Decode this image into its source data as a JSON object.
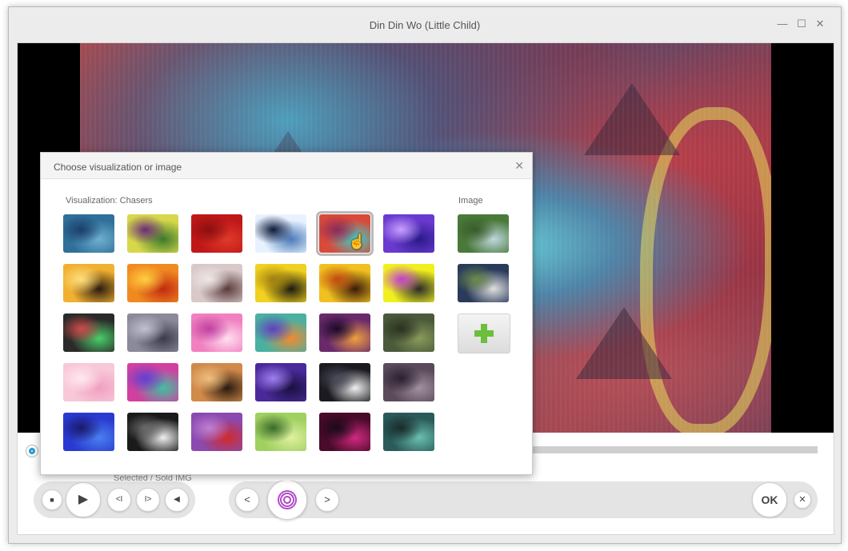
{
  "window": {
    "title": "Din Din Wo (Little Child)",
    "minimize_icon": "minimize-icon",
    "maximize_icon": "maximize-icon",
    "close_icon": "close-icon",
    "minimize_glyph": "—",
    "maximize_glyph": "☐",
    "close_glyph": "✕"
  },
  "dialog": {
    "title": "Choose visualization or image",
    "close_glyph": "✕",
    "visualization_label": "Visualization: Chasers",
    "image_label": "Image",
    "selected_index": 4,
    "visualizations": [
      {
        "name": "blue-smoke",
        "colors": [
          "#2f6f9a",
          "#6fb0d0",
          "#1b3d6a"
        ]
      },
      {
        "name": "green-burst",
        "colors": [
          "#d6d84a",
          "#3b7a2a",
          "#6a2a7a"
        ]
      },
      {
        "name": "red-plane",
        "colors": [
          "#c01818",
          "#e03a2a",
          "#8a0f0f"
        ]
      },
      {
        "name": "light-tunnel",
        "colors": [
          "#e8f2ff",
          "#4a7ab8",
          "#0c1a3a"
        ]
      },
      {
        "name": "kaleido-teal",
        "colors": [
          "#d84a3a",
          "#3ad0c8",
          "#8a2a5a"
        ]
      },
      {
        "name": "purple-glow",
        "colors": [
          "#6a3ad0",
          "#2a1a8a",
          "#c8a0ff"
        ]
      },
      {
        "name": "gold-streak",
        "colors": [
          "#f0b030",
          "#2a1a10",
          "#ffe080"
        ]
      },
      {
        "name": "fire-nebula",
        "colors": [
          "#f08a20",
          "#c02a10",
          "#ffd040"
        ]
      },
      {
        "name": "film-strip",
        "colors": [
          "#d8c8c8",
          "#5a3a3a",
          "#f0e8e8"
        ]
      },
      {
        "name": "yellow-spikes",
        "colors": [
          "#f0d020",
          "#1a1a10",
          "#a08010"
        ]
      },
      {
        "name": "golden-mask",
        "colors": [
          "#f0c020",
          "#3a1a0a",
          "#c04a10"
        ]
      },
      {
        "name": "stick-dancer",
        "colors": [
          "#f0f020",
          "#2a2a2a",
          "#c040d0"
        ]
      },
      {
        "name": "stick-figures",
        "colors": [
          "#2a2a2a",
          "#4ad06a",
          "#d04a4a"
        ]
      },
      {
        "name": "grey-vortex",
        "colors": [
          "#8a8a9a",
          "#3a3a4a",
          "#c0c0d0"
        ]
      },
      {
        "name": "pink-swirl",
        "colors": [
          "#f080c0",
          "#ffe0f0",
          "#c040a0"
        ]
      },
      {
        "name": "rainbow-ring",
        "colors": [
          "#4ab0a0",
          "#f08a30",
          "#6040c0"
        ]
      },
      {
        "name": "purple-cells",
        "colors": [
          "#6a2a6a",
          "#f0a040",
          "#1a0a2a"
        ]
      },
      {
        "name": "green-lattice",
        "colors": [
          "#4a5a3a",
          "#8a9a5a",
          "#2a3020"
        ]
      },
      {
        "name": "pink-dots",
        "colors": [
          "#f8c8d8",
          "#f0a0c0",
          "#ffe8f0"
        ]
      },
      {
        "name": "rainbow-threads",
        "colors": [
          "#d040a0",
          "#40c0a0",
          "#6040d0"
        ]
      },
      {
        "name": "copper-swirl",
        "colors": [
          "#d08a4a",
          "#2a1a10",
          "#f0c080"
        ]
      },
      {
        "name": "violet-galaxy",
        "colors": [
          "#4a2a9a",
          "#1a1040",
          "#a080f0"
        ]
      },
      {
        "name": "star-field",
        "colors": [
          "#1a1a20",
          "#f0f0f0",
          "#4a4a5a"
        ]
      },
      {
        "name": "dusky-nebula",
        "colors": [
          "#5a4a5a",
          "#a090a0",
          "#2a2030"
        ]
      },
      {
        "name": "blue-bokeh",
        "colors": [
          "#2a3ad0",
          "#4a80f0",
          "#1a1a6a"
        ]
      },
      {
        "name": "mono-eye",
        "colors": [
          "#1a1a1a",
          "#f0f0f0",
          "#6a6a6a"
        ]
      },
      {
        "name": "red-ribbons",
        "colors": [
          "#8a4ab0",
          "#d02a2a",
          "#c080d0"
        ]
      },
      {
        "name": "green-rays",
        "colors": [
          "#a0d060",
          "#e0f0a0",
          "#3a6a2a"
        ]
      },
      {
        "name": "magenta-arc",
        "colors": [
          "#4a0a2a",
          "#d02a80",
          "#1a0a1a"
        ]
      },
      {
        "name": "teal-waves",
        "colors": [
          "#2a5a5a",
          "#6ac0b0",
          "#1a2a2a"
        ]
      }
    ],
    "images": [
      {
        "name": "waterfall-photo",
        "colors": [
          "#4a7a3a",
          "#c0d8e0",
          "#3a5a2a"
        ]
      },
      {
        "name": "collage-photo",
        "colors": [
          "#2a3a5a",
          "#e0e0e0",
          "#6a8a4a"
        ]
      }
    ],
    "add_image_icon": "plus-icon"
  },
  "controls": {
    "stop_glyph": "■",
    "play_glyph": "▶",
    "prev_glyph": "<I",
    "next_glyph": "I>",
    "volume_glyph": "◀",
    "viz_prev_glyph": "<",
    "viz_next_glyph": ">",
    "ok_label": "OK",
    "cancel_glyph": "✕",
    "caption": "Selected / Sold IMG"
  },
  "colors": {
    "accent": "#2b9bd0",
    "spiral": "#b24bc9",
    "add_plus": "#6cbf3d"
  }
}
